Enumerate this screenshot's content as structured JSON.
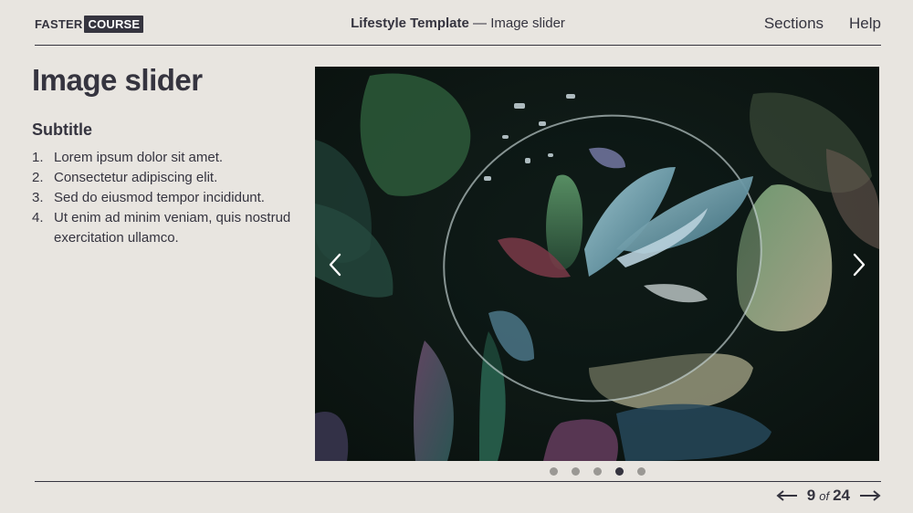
{
  "header": {
    "logo": {
      "part1": "FASTER",
      "part2": "COURSE"
    },
    "title_bold": "Lifestyle Template",
    "title_sep": " — ",
    "title_rest": "Image slider",
    "nav": [
      {
        "label": "Sections"
      },
      {
        "label": "Help"
      }
    ]
  },
  "main": {
    "title": "Image slider",
    "subtitle": "Subtitle",
    "list": [
      {
        "num": "1.",
        "text": "Lorem ipsum dolor sit amet."
      },
      {
        "num": "2.",
        "text": "Consectetur adipiscing elit."
      },
      {
        "num": "3.",
        "text": "Sed do eiusmod tempor incididunt."
      },
      {
        "num": "4.",
        "text": "Ut enim ad minim veniam, quis nostrud exercitation ullamco."
      }
    ]
  },
  "slider": {
    "image_alt": "Dark green and blue leaves seen through a glass lens",
    "prev_icon": "chevron-left-icon",
    "next_icon": "chevron-right-icon",
    "dot_count": 5,
    "active_dot": 4
  },
  "pager": {
    "current": "9",
    "of": "of",
    "total": "24",
    "prev_icon": "arrow-left-icon",
    "next_icon": "arrow-right-icon"
  },
  "colors": {
    "background": "#e8e5e0",
    "text": "#35343f",
    "dot_inactive": "#9a9894",
    "dot_active": "#35343f"
  }
}
